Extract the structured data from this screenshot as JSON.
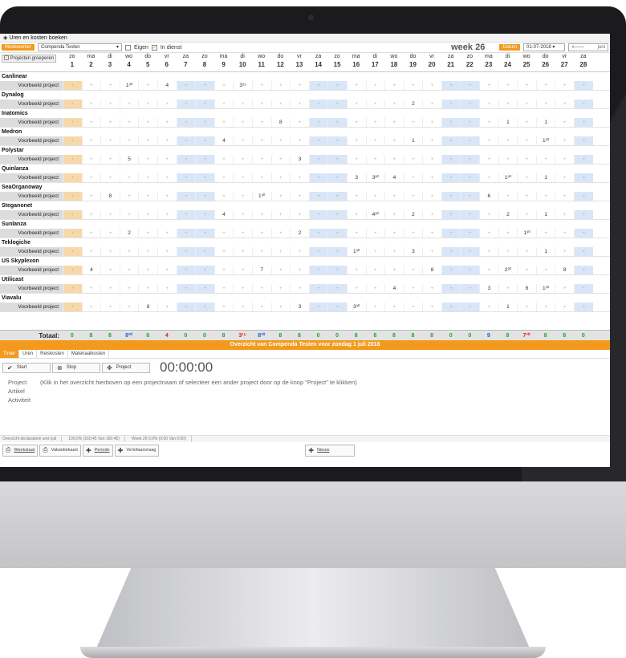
{
  "window": {
    "title": "Uren en kosten boeken"
  },
  "toolbar": {
    "employee_label": "Medewerker",
    "employee_value": "Compenda Testen",
    "eigen_label": "Eigen",
    "indienst_label": "In dienst",
    "week_label": "week 26",
    "date_label": "Datum",
    "date_value": "01-07-2018",
    "month_nav": "juni"
  },
  "grid": {
    "group_button": "Projecten groeperen",
    "days": [
      {
        "d": "zo",
        "n": "1"
      },
      {
        "d": "ma",
        "n": "2"
      },
      {
        "d": "di",
        "n": "3"
      },
      {
        "d": "wo",
        "n": "4"
      },
      {
        "d": "do",
        "n": "5"
      },
      {
        "d": "vr",
        "n": "6"
      },
      {
        "d": "za",
        "n": "7"
      },
      {
        "d": "zo",
        "n": "8"
      },
      {
        "d": "ma",
        "n": "9"
      },
      {
        "d": "di",
        "n": "10"
      },
      {
        "d": "wo",
        "n": "11"
      },
      {
        "d": "do",
        "n": "12"
      },
      {
        "d": "vr",
        "n": "13"
      },
      {
        "d": "za",
        "n": "14"
      },
      {
        "d": "zo",
        "n": "15"
      },
      {
        "d": "ma",
        "n": "16"
      },
      {
        "d": "di",
        "n": "17"
      },
      {
        "d": "wo",
        "n": "18"
      },
      {
        "d": "do",
        "n": "19"
      },
      {
        "d": "vr",
        "n": "20"
      },
      {
        "d": "za",
        "n": "21"
      },
      {
        "d": "zo",
        "n": "22"
      },
      {
        "d": "ma",
        "n": "23"
      },
      {
        "d": "di",
        "n": "24"
      },
      {
        "d": "wo",
        "n": "25"
      },
      {
        "d": "do",
        "n": "26"
      },
      {
        "d": "vr",
        "n": "27"
      },
      {
        "d": "za",
        "n": "28"
      }
    ],
    "groups": [
      {
        "name": "Canlinear",
        "project": "Voorbeeld project",
        "values": {
          "4": "1³⁰",
          "6": "4",
          "10": "3¹⁵"
        }
      },
      {
        "name": "Dynalog",
        "project": "Voorbeeld project",
        "values": {
          "19": "2"
        }
      },
      {
        "name": "Inatomics",
        "project": "Voorbeeld project",
        "values": {
          "12": "8",
          "24": "1",
          "26": "1"
        }
      },
      {
        "name": "Medron",
        "project": "Voorbeeld project",
        "values": {
          "9": "4",
          "19": "1",
          "26": "1³⁰"
        }
      },
      {
        "name": "Polystar",
        "project": "Voorbeeld project",
        "values": {
          "4": "5",
          "13": "3"
        }
      },
      {
        "name": "Quinlanza",
        "project": "Voorbeeld project",
        "values": {
          "16": "3",
          "17": "3³⁰",
          "18": "4",
          "24": "1³⁰",
          "26": "1"
        }
      },
      {
        "name": "SeaOrganoway",
        "project": "Voorbeeld project",
        "values": {
          "3": "8",
          "11": "1³⁰",
          "23": "6"
        }
      },
      {
        "name": "Steganonet",
        "project": "Voorbeeld project",
        "values": {
          "9": "4",
          "17": "4³⁰",
          "19": "2",
          "24": "2",
          "26": "1"
        }
      },
      {
        "name": "Sunlanza",
        "project": "Voorbeeld project",
        "values": {
          "4": "2",
          "13": "2",
          "25": "1³⁰"
        }
      },
      {
        "name": "Teklogiche",
        "project": "Voorbeeld project",
        "values": {
          "16": "1³⁰",
          "19": "3",
          "26": "1"
        }
      },
      {
        "name": "US Skyplexon",
        "project": "Voorbeeld project",
        "values": {
          "2": "4",
          "11": "7",
          "20": "8",
          "24": "2³⁰",
          "27": "8"
        }
      },
      {
        "name": "Utilicast",
        "project": "Voorbeeld project",
        "values": {
          "18": "4",
          "23": "3",
          "25": "6",
          "26": "1³⁰"
        }
      },
      {
        "name": "Viavalu",
        "project": "Voorbeeld project",
        "values": {
          "5": "8",
          "13": "3",
          "16": "3³⁰",
          "24": "1"
        }
      }
    ],
    "total_label": "Totaal:",
    "totals": [
      {
        "v": "0",
        "c": "#2a9d2a"
      },
      {
        "v": "8",
        "c": "#2a9d2a"
      },
      {
        "v": "8",
        "c": "#2a9d2a"
      },
      {
        "v": "8³⁰",
        "c": "#1c5fd0"
      },
      {
        "v": "8",
        "c": "#2a9d2a"
      },
      {
        "v": "4",
        "c": "#e02020"
      },
      {
        "v": "0",
        "c": "#2a9d2a"
      },
      {
        "v": "0",
        "c": "#2a9d2a"
      },
      {
        "v": "8",
        "c": "#2a9d2a"
      },
      {
        "v": "3¹⁵",
        "c": "#e02020"
      },
      {
        "v": "8³⁰",
        "c": "#1c5fd0"
      },
      {
        "v": "8",
        "c": "#2a9d2a"
      },
      {
        "v": "8",
        "c": "#2a9d2a"
      },
      {
        "v": "0",
        "c": "#2a9d2a"
      },
      {
        "v": "0",
        "c": "#2a9d2a"
      },
      {
        "v": "8",
        "c": "#2a9d2a"
      },
      {
        "v": "8",
        "c": "#2a9d2a"
      },
      {
        "v": "8",
        "c": "#2a9d2a"
      },
      {
        "v": "8",
        "c": "#2a9d2a"
      },
      {
        "v": "8",
        "c": "#2a9d2a"
      },
      {
        "v": "0",
        "c": "#2a9d2a"
      },
      {
        "v": "0",
        "c": "#2a9d2a"
      },
      {
        "v": "9",
        "c": "#1c5fd0"
      },
      {
        "v": "8",
        "c": "#2a9d2a"
      },
      {
        "v": "7³⁰",
        "c": "#e02020"
      },
      {
        "v": "8",
        "c": "#2a9d2a"
      },
      {
        "v": "8",
        "c": "#2a9d2a"
      },
      {
        "v": "0",
        "c": "#2a9d2a"
      }
    ]
  },
  "overview": {
    "title": "Overzicht van Compenda Testen voor zondag 1 juli 2018"
  },
  "tabs": [
    "Timer",
    "Uren",
    "Reiskosten",
    "Materiaalkosten"
  ],
  "timer": {
    "start_label": "Start",
    "stop_label": "Stop",
    "project_label": "Project",
    "time": "00:00:00",
    "project_field": "Project",
    "project_hint": "(Klik in het overzicht hierboven op een projectnaam of selecteer een ander project door op de knop \"Project\" te klikken)",
    "artikel_field": "Artikel",
    "activiteit_field": "Activiteit"
  },
  "status": {
    "s1": "Overzicht declarabele uren juli",
    "s2": "100,0% (160:45 Van 160:45)",
    "s3": "Week 26 0,0% (0:00 Van 0:00)"
  },
  "bottom": {
    "weekstaat": "Weekstaat",
    "vakantie": "Vakantiekaart",
    "periode": "Periode",
    "verlof": "Verlofaanvraag",
    "nieuw": "Nieuw"
  }
}
